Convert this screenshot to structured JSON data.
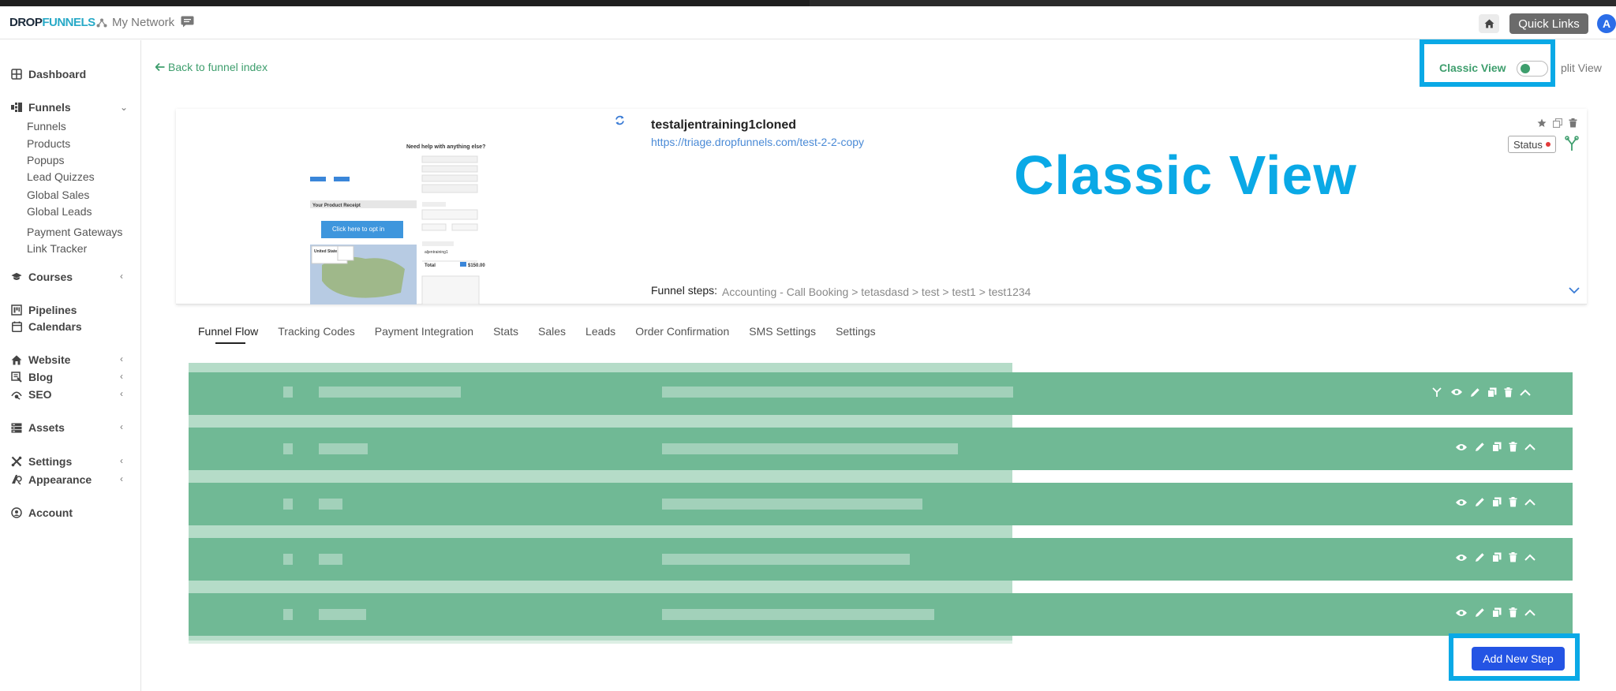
{
  "header": {
    "logo_part1": "DROP",
    "logo_part2": "FUNNELS",
    "my_network": "My Network",
    "quick_links": "Quick Links",
    "avatar_initial": "A"
  },
  "sidebar": {
    "dashboard": "Dashboard",
    "funnels": "Funnels",
    "funnels_sub": [
      "Funnels",
      "Products",
      "Popups",
      "Lead Quizzes",
      "Global Sales",
      "Global Leads",
      "Payment Gateways",
      "Link Tracker"
    ],
    "courses": "Courses",
    "pipelines": "Pipelines",
    "calendars": "Calendars",
    "website": "Website",
    "blog": "Blog",
    "seo": "SEO",
    "assets": "Assets",
    "settings": "Settings",
    "appearance": "Appearance",
    "account": "Account"
  },
  "main": {
    "back_link": "Back to funnel index",
    "classic_view": "Classic View",
    "split_view": "plit View",
    "overlay_title": "Classic View"
  },
  "funnel": {
    "title": "testaljentraining1cloned",
    "url": "https://triage.dropfunnels.com/test-2-2-copy",
    "status": "Status",
    "steps_label": "Funnel steps:",
    "steps_path": "Accounting - Call Booking > tetasdasd > test > test1 > test1234"
  },
  "thumbnail": {
    "help_text": "Need help with anything else?",
    "receipt": "Your Product Receipt",
    "optin": "Click here to opt in",
    "product_line": "aljentraining1",
    "total_label": "Total",
    "total_value": "$150.00",
    "map_country": "United States"
  },
  "tabs": [
    "Funnel Flow",
    "Tracking Codes",
    "Payment Integration",
    "Stats",
    "Sales",
    "Leads",
    "Order Confirmation",
    "SMS Settings",
    "Settings"
  ],
  "actions": {
    "add_new_step": "Add New Step"
  },
  "colors": {
    "accent_green": "#3e9e6d",
    "row_green": "#70b995",
    "highlight_blue": "#0aa9e6",
    "button_blue": "#2454e4"
  }
}
